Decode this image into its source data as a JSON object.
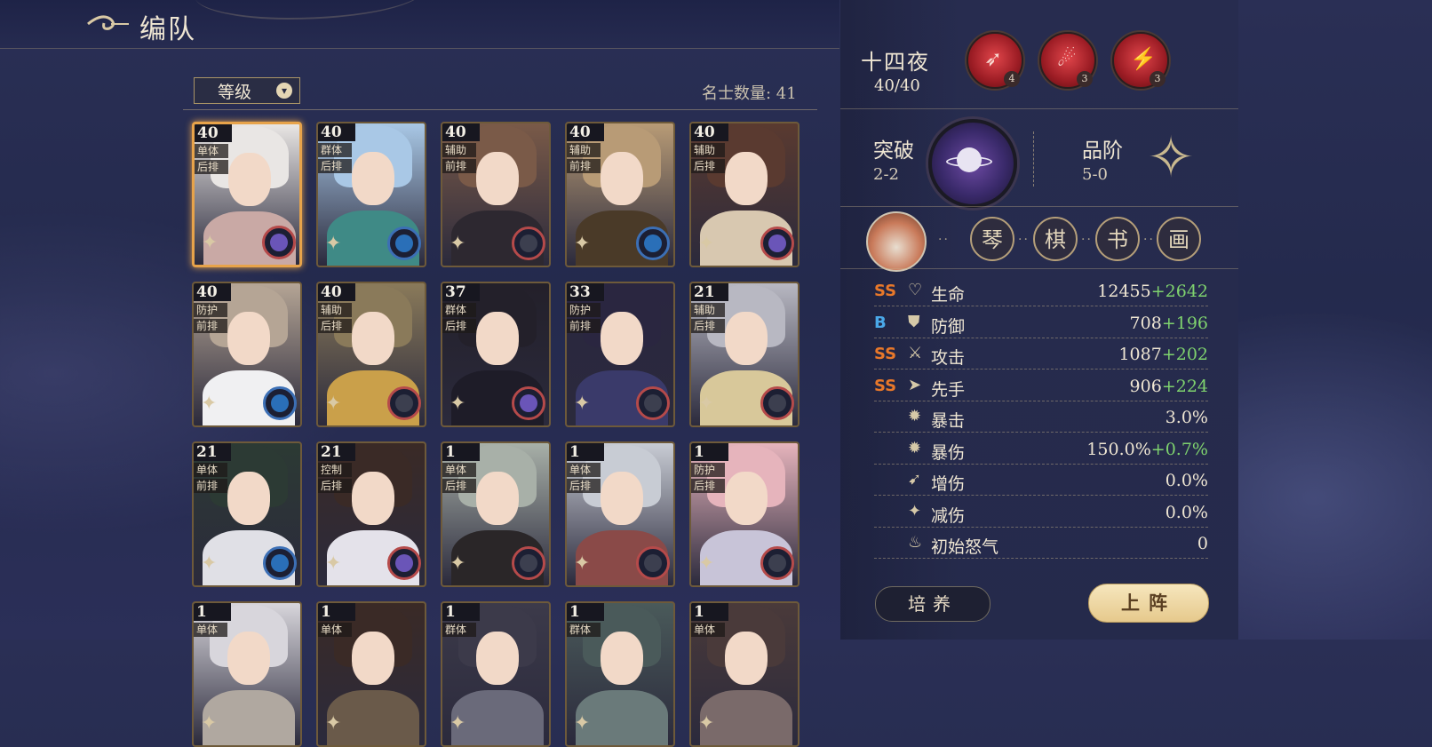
{
  "header": {
    "title": "编队"
  },
  "filter": {
    "sort_label": "等级",
    "count_label": "名士数量: 41"
  },
  "cards": [
    {
      "level": "40",
      "role": "单体",
      "row": "后排",
      "ring": "purple",
      "hair": "#e9e6e4",
      "body": "#c9a9a5",
      "selected": true
    },
    {
      "level": "40",
      "role": "群体",
      "row": "后排",
      "ring": "blue",
      "hair": "#a9c8e6",
      "body": "#3f8a86",
      "selected": false
    },
    {
      "level": "40",
      "role": "辅助",
      "row": "前排",
      "ring": "dark",
      "hair": "#7a5a48",
      "body": "#2d2830",
      "selected": false
    },
    {
      "level": "40",
      "role": "辅助",
      "row": "前排",
      "ring": "blue",
      "hair": "#b89b76",
      "body": "#4a3a28",
      "selected": false
    },
    {
      "level": "40",
      "role": "辅助",
      "row": "后排",
      "ring": "purple",
      "hair": "#5a3a30",
      "body": "#d8c8b0",
      "selected": false
    },
    {
      "level": "40",
      "role": "防护",
      "row": "前排",
      "ring": "blue",
      "hair": "#b5a595",
      "body": "#f0f0f2",
      "selected": false
    },
    {
      "level": "40",
      "role": "辅助",
      "row": "后排",
      "ring": "dark",
      "hair": "#8a7a5a",
      "body": "#caa04a",
      "selected": false
    },
    {
      "level": "37",
      "role": "群体",
      "row": "后排",
      "ring": "purple",
      "hair": "#23202a",
      "body": "#1e1c28",
      "selected": false
    },
    {
      "level": "33",
      "role": "防护",
      "row": "前排",
      "ring": "dark",
      "hair": "#2a2640",
      "body": "#3a3a6a",
      "selected": false
    },
    {
      "level": "21",
      "role": "辅助",
      "row": "后排",
      "ring": "dark",
      "hair": "#b8b8c2",
      "body": "#d8c89a",
      "selected": false
    },
    {
      "level": "21",
      "role": "单体",
      "row": "前排",
      "ring": "blue",
      "hair": "#2c3a34",
      "body": "#e0e0e6",
      "selected": false
    },
    {
      "level": "21",
      "role": "控制",
      "row": "后排",
      "ring": "purple",
      "hair": "#3a2a26",
      "body": "#e4e2ea",
      "selected": false
    },
    {
      "level": "1",
      "role": "单体",
      "row": "后排",
      "ring": "dark",
      "hair": "#a8b0a8",
      "body": "#2a2628",
      "selected": false
    },
    {
      "level": "1",
      "role": "单体",
      "row": "后排",
      "ring": "dark",
      "hair": "#c8ccd4",
      "body": "#8a4a48",
      "selected": false
    },
    {
      "level": "1",
      "role": "防护",
      "row": "后排",
      "ring": "dark",
      "hair": "#e6b4bc",
      "body": "#c8c4d8",
      "selected": false
    },
    {
      "level": "1",
      "role": "单体",
      "row": "",
      "ring": "none",
      "hair": "#d8d6dc",
      "body": "#b0a8a0",
      "selected": false
    },
    {
      "level": "1",
      "role": "单体",
      "row": "",
      "ring": "none",
      "hair": "#3a2a26",
      "body": "#6a5a4a",
      "selected": false
    },
    {
      "level": "1",
      "role": "群体",
      "row": "",
      "ring": "none",
      "hair": "#3c3a4a",
      "body": "#6a6a7a",
      "selected": false
    },
    {
      "level": "1",
      "role": "群体",
      "row": "",
      "ring": "none",
      "hair": "#4a5a5a",
      "body": "#6a7a7a",
      "selected": false
    },
    {
      "level": "1",
      "role": "单体",
      "row": "",
      "ring": "none",
      "hair": "#4a3a3a",
      "body": "#7a6a6a",
      "selected": false
    }
  ],
  "hero": {
    "name": "十四夜",
    "level": "40/40",
    "skills": [
      {
        "icon": "arrow-skill-icon",
        "glyph": "➶",
        "count": "4"
      },
      {
        "icon": "swirl-skill-icon",
        "glyph": "☄",
        "count": "3"
      },
      {
        "icon": "slash-skill-icon",
        "glyph": "⚡",
        "count": "3"
      }
    ],
    "breakthrough_label": "突破",
    "breakthrough_value": "2-2",
    "rank_label": "品阶",
    "rank_value": "5-0",
    "arts": [
      "琴",
      "棋",
      "书",
      "画"
    ]
  },
  "stats": [
    {
      "grade": "SS",
      "grade_color": "#e8782a",
      "icon": "♡",
      "name": "生命",
      "base": "12455",
      "bonus": "+2642"
    },
    {
      "grade": "B",
      "grade_color": "#4aa8e8",
      "icon": "⛊",
      "name": "防御",
      "base": "708",
      "bonus": "+196"
    },
    {
      "grade": "SS",
      "grade_color": "#e8782a",
      "icon": "⚔",
      "name": "攻击",
      "base": "1087",
      "bonus": "+202"
    },
    {
      "grade": "SS",
      "grade_color": "#e8782a",
      "icon": "➤",
      "name": "先手",
      "base": "906",
      "bonus": "+224"
    },
    {
      "grade": "",
      "grade_color": "#e8782a",
      "icon": "✹",
      "name": "暴击",
      "base": "3.0%",
      "bonus": ""
    },
    {
      "grade": "",
      "grade_color": "#e8782a",
      "icon": "✹",
      "name": "暴伤",
      "base": "150.0%",
      "bonus": "+0.7%"
    },
    {
      "grade": "",
      "grade_color": "#e8782a",
      "icon": "➹",
      "name": "增伤",
      "base": "0.0%",
      "bonus": ""
    },
    {
      "grade": "",
      "grade_color": "#e8782a",
      "icon": "✦",
      "name": "减伤",
      "base": "0.0%",
      "bonus": ""
    },
    {
      "grade": "",
      "grade_color": "#e8782a",
      "icon": "♨",
      "name": "初始怒气",
      "base": "0",
      "bonus": ""
    }
  ],
  "actions": {
    "train": "培养",
    "deploy": "上阵"
  }
}
